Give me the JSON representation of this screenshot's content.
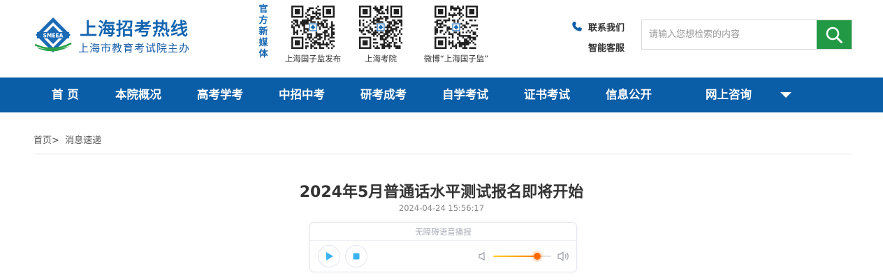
{
  "header": {
    "logo": {
      "mark_text": "SMEEA",
      "title": "上海招考热线",
      "subtitle": "上海市教育考试院主办"
    },
    "media_label": "官方新媒体",
    "qr_codes": [
      {
        "caption": "上海国子监发布"
      },
      {
        "caption": "上海考院"
      },
      {
        "caption": "微博“上海国子监”"
      }
    ],
    "contact": {
      "contact_us": "联系我们",
      "service": "智能客服"
    },
    "search": {
      "placeholder": "请输入您想检索的内容"
    }
  },
  "nav": {
    "items": [
      {
        "label": "首 页"
      },
      {
        "label": "本院概况"
      },
      {
        "label": "高考学考"
      },
      {
        "label": "中招中考"
      },
      {
        "label": "研考成考"
      },
      {
        "label": "自学考试"
      },
      {
        "label": "证书考试"
      },
      {
        "label": "信息公开"
      },
      {
        "label": "网上咨询"
      }
    ]
  },
  "breadcrumb": {
    "home": "首页",
    "separator": ">",
    "current": "消息速递"
  },
  "article": {
    "title": "2024年5月普通话水平测试报名即将开始",
    "date": "2024-04-24 15:56:17"
  },
  "player": {
    "label": "无障碍语音播报",
    "volume": 0.76
  },
  "colors": {
    "brand_blue": "#0a5da7",
    "search_green": "#229944",
    "volume_orange": "#ff6a00",
    "player_blue": "#3bb3f0"
  }
}
